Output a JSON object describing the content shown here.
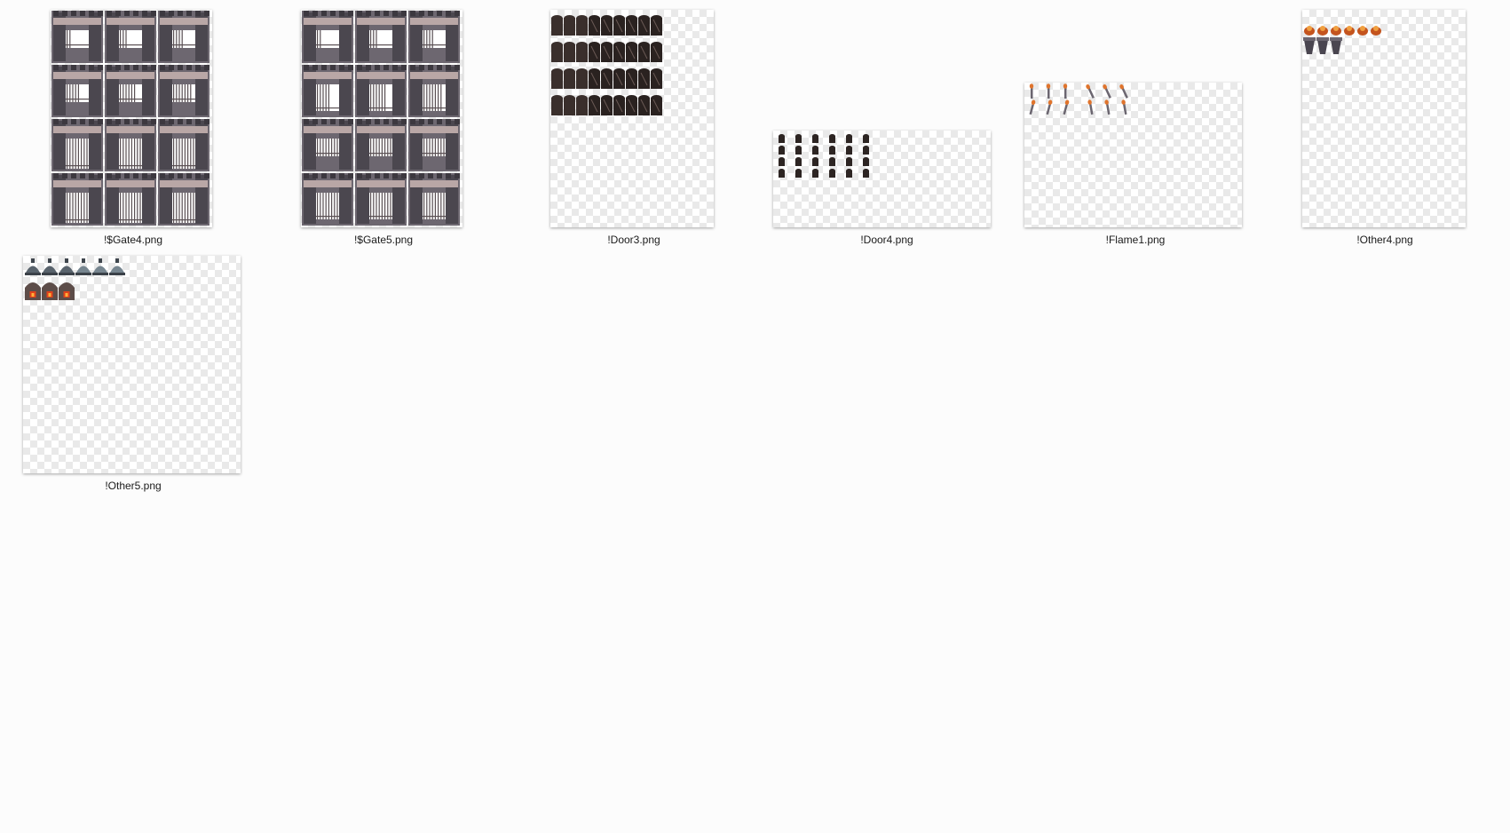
{
  "window": {
    "background_color": "#fcfcfc"
  },
  "files": [
    {
      "name": "!$Gate4.png",
      "icon": "gate-tileset-thumbnail"
    },
    {
      "name": "!$Gate5.png",
      "icon": "gate-tileset-thumbnail"
    },
    {
      "name": "!Door3.png",
      "icon": "door-tileset-thumbnail"
    },
    {
      "name": "!Door4.png",
      "icon": "door-tileset-thumbnail"
    },
    {
      "name": "!Flame1.png",
      "icon": "torch-tileset-thumbnail"
    },
    {
      "name": "!Other4.png",
      "icon": "brazier-tileset-thumbnail"
    },
    {
      "name": "!Other5.png",
      "icon": "bell-furnace-tileset-thumbnail"
    }
  ]
}
